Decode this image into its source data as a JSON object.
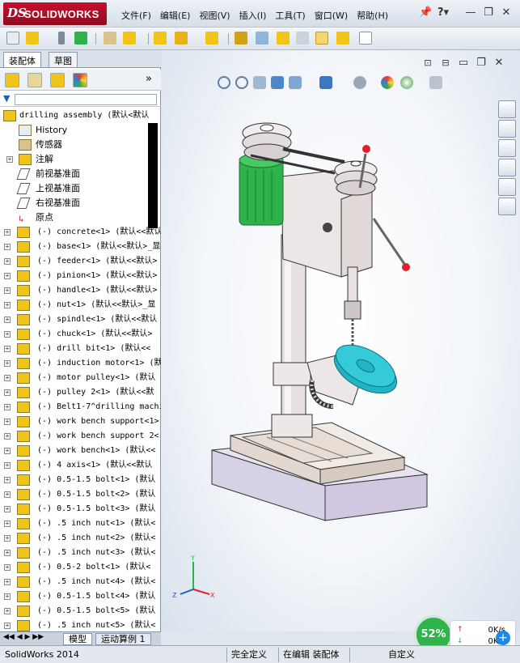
{
  "app": {
    "brand_prefix": "DS",
    "brand_name": "SOLIDWORKS"
  },
  "menu": [
    "文件(F)",
    "编辑(E)",
    "视图(V)",
    "插入(I)",
    "工具(T)",
    "窗口(W)",
    "帮助(H)"
  ],
  "title_icons": [
    "pushpin-icon",
    "help-icon"
  ],
  "window_buttons": [
    "minimize-icon",
    "restore-icon",
    "close-icon"
  ],
  "panel": {
    "tabs": [
      "装配体",
      "草图"
    ],
    "filter_icon": "filter-icon",
    "tree": [
      {
        "label": "drilling assembly  (默认<默认",
        "icon": "assembly-icon",
        "expander": "-",
        "indent": 0
      },
      {
        "label": "History",
        "icon": "history-icon",
        "expander": "",
        "indent": 1
      },
      {
        "label": "传感器",
        "icon": "sensor-icon",
        "expander": "",
        "indent": 1
      },
      {
        "label": "注解",
        "icon": "annotation-icon",
        "expander": "+",
        "indent": 1
      },
      {
        "label": "前视基准面",
        "icon": "plane-icon",
        "expander": "",
        "indent": 1
      },
      {
        "label": "上视基准面",
        "icon": "plane-icon",
        "expander": "",
        "indent": 1
      },
      {
        "label": "右视基准面",
        "icon": "plane-icon",
        "expander": "",
        "indent": 1
      },
      {
        "label": "原点",
        "icon": "origin-icon",
        "expander": "",
        "indent": 1
      },
      {
        "label": "(-) concrete<1> (默认<<默认",
        "icon": "part-icon",
        "expander": "+",
        "indent": 0
      },
      {
        "label": "(-) base<1> (默认<<默认>_显",
        "icon": "part-icon",
        "expander": "+",
        "indent": 0
      },
      {
        "label": "(-) feeder<1> (默认<<默认>",
        "icon": "part-icon",
        "expander": "+",
        "indent": 0
      },
      {
        "label": "(-) pinion<1> (默认<<默认>",
        "icon": "part-icon",
        "expander": "+",
        "indent": 0
      },
      {
        "label": "(-) handle<1> (默认<<默认>",
        "icon": "part-icon",
        "expander": "+",
        "indent": 0
      },
      {
        "label": "(-) nut<1> (默认<<默认>_显",
        "icon": "part-icon",
        "expander": "+",
        "indent": 0
      },
      {
        "label": "(-) spindle<1> (默认<<默认",
        "icon": "part-icon",
        "expander": "+",
        "indent": 0
      },
      {
        "label": "(-) chuck<1> (默认<<默认>",
        "icon": "part-icon",
        "expander": "+",
        "indent": 0
      },
      {
        "label": "(-) drill bit<1> (默认<<",
        "icon": "part-icon",
        "expander": "+",
        "indent": 0
      },
      {
        "label": "(-) induction motor<1> (默",
        "icon": "part-icon",
        "expander": "+",
        "indent": 0
      },
      {
        "label": "(-) motor pulley<1> (默认",
        "icon": "part-icon",
        "expander": "+",
        "indent": 0
      },
      {
        "label": "(-) pulley 2<1> (默认<<默",
        "icon": "part-icon",
        "expander": "+",
        "indent": 0
      },
      {
        "label": "(-) Belt1-7^drilling machi",
        "icon": "part-icon",
        "expander": "+",
        "indent": 0
      },
      {
        "label": "(-) work bench support<1>",
        "icon": "part-icon",
        "expander": "+",
        "indent": 0
      },
      {
        "label": "(-) work bench support 2<",
        "icon": "part-icon",
        "expander": "+",
        "indent": 0
      },
      {
        "label": "(-) work bench<1> (默认<<",
        "icon": "part-icon",
        "expander": "+",
        "indent": 0
      },
      {
        "label": "(-) 4 axis<1> (默认<<默认",
        "icon": "part-icon",
        "expander": "+",
        "indent": 0
      },
      {
        "label": "(-) 0.5-1.5 bolt<1> (默认",
        "icon": "part-icon",
        "expander": "+",
        "indent": 0
      },
      {
        "label": "(-) 0.5-1.5 bolt<2> (默认",
        "icon": "part-icon",
        "expander": "+",
        "indent": 0
      },
      {
        "label": "(-) 0.5-1.5 bolt<3> (默认",
        "icon": "part-icon",
        "expander": "+",
        "indent": 0
      },
      {
        "label": "(-) .5 inch nut<1> (默认<",
        "icon": "part-icon",
        "expander": "+",
        "indent": 0
      },
      {
        "label": "(-) .5 inch nut<2> (默认<",
        "icon": "part-icon",
        "expander": "+",
        "indent": 0
      },
      {
        "label": "(-) .5 inch nut<3> (默认<",
        "icon": "part-icon",
        "expander": "+",
        "indent": 0
      },
      {
        "label": "(-) 0.5-2 bolt<1> (默认<",
        "icon": "part-icon",
        "expander": "+",
        "indent": 0
      },
      {
        "label": "(-) .5 inch nut<4> (默认<",
        "icon": "part-icon",
        "expander": "+",
        "indent": 0
      },
      {
        "label": "(-) 0.5-1.5 bolt<4> (默认",
        "icon": "part-icon",
        "expander": "+",
        "indent": 0
      },
      {
        "label": "(-) 0.5-1.5 bolt<5> (默认",
        "icon": "part-icon",
        "expander": "+",
        "indent": 0
      },
      {
        "label": "(-) .5 inch nut<5> (默认<",
        "icon": "part-icon",
        "expander": "+",
        "indent": 0
      }
    ],
    "bottom_tabs": [
      "模型",
      "运动算例 1"
    ]
  },
  "status": {
    "app_version": "SolidWorks 2014",
    "definition": "完全定义",
    "editing": "在编辑 装配体",
    "custom": "自定义"
  },
  "network": {
    "percent": "52%",
    "up_speed": "0K/s",
    "down_speed": "0K/s",
    "add_label": "+"
  },
  "colors": {
    "accent_red": "#c8102e",
    "motor_green": "#2db34a",
    "wheel_cyan": "#1fb5c4",
    "part_yellow": "#f0c419",
    "net_green": "#2fb34a"
  }
}
